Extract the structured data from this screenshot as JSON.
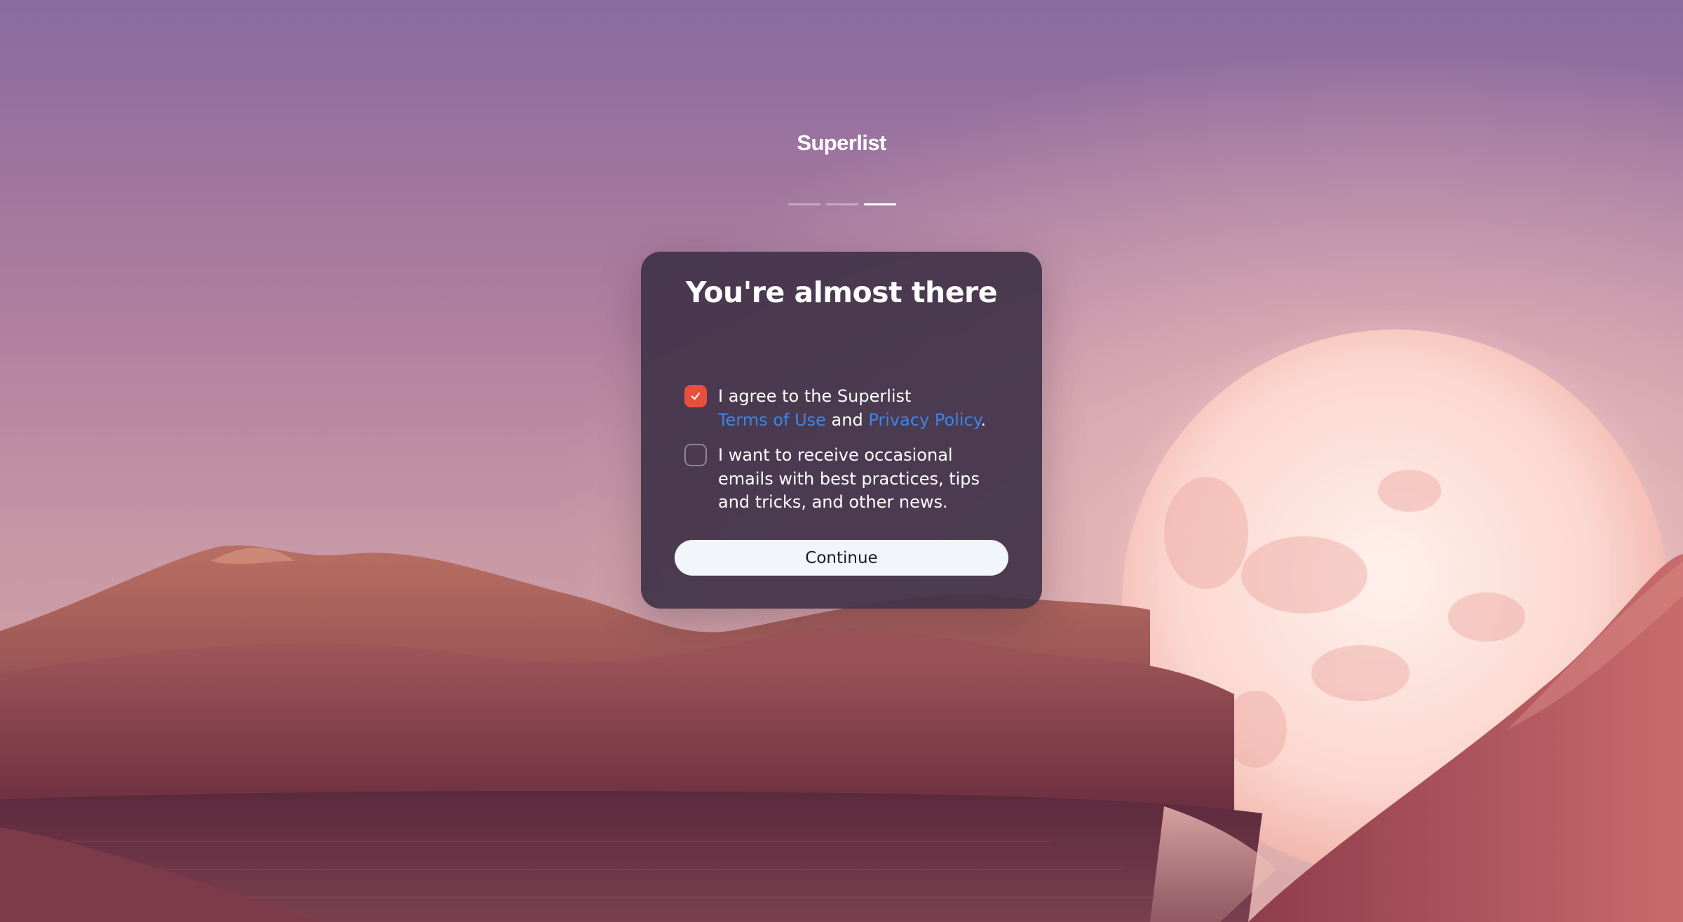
{
  "brand": {
    "name": "Superlist"
  },
  "progress": {
    "total_steps": 3,
    "current_step": 3
  },
  "dialog": {
    "title": "You're almost there",
    "terms": {
      "checked": true,
      "prefix": "I agree to the Superlist",
      "terms_link": "Terms of Use",
      "conjunction": "and",
      "privacy_link": "Privacy Policy",
      "suffix": "."
    },
    "emails": {
      "checked": false,
      "label": "I want to receive occasional emails with best practices, tips and tricks, and other news."
    },
    "continue_label": "Continue"
  },
  "colors": {
    "checkbox_checked": "#e8503d",
    "link": "#3b86ea",
    "card_background": "#403248",
    "button_background": "#f3f5fd"
  },
  "icons": {
    "checkmark": "checkmark-icon"
  }
}
